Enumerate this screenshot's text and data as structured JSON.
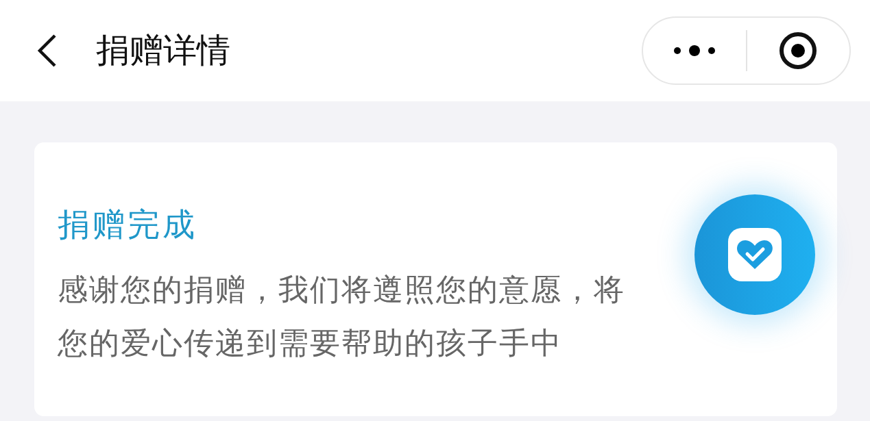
{
  "nav_bar": {
    "title": "捐赠详情"
  },
  "card": {
    "status_title": "捐赠完成",
    "message": "感谢您的捐赠，我们将遵照您的意愿，将您的爱心传递到需要帮助的孩子手中"
  }
}
